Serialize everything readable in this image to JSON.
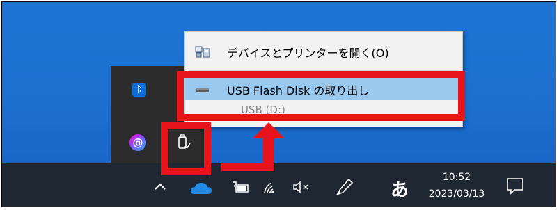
{
  "context_menu": {
    "open_devices_label": "デバイスとプリンターを開く(O)",
    "eject_label": "USB Flash Disk の取り出し",
    "drive_label": "USB (D:)"
  },
  "taskbar": {
    "time": "10:52",
    "date": "2023/03/13",
    "ime_indicator": "あ"
  },
  "icons": {
    "bluetooth": "bluetooth-icon",
    "app_at": "at-app-icon",
    "usb_safely_remove": "usb-safely-remove-icon",
    "chevron": "show-hidden-icons",
    "onedrive": "onedrive-cloud-icon",
    "battery": "battery-icon",
    "wifi": "wifi-icon",
    "volume": "volume-muted-icon",
    "pen": "pen-icon",
    "notification": "notification-icon"
  },
  "colors": {
    "highlight": "#e8141b",
    "menu_selected": "#99c9ef",
    "taskbar": "#1f2733",
    "desktop": "#1d70d0"
  }
}
